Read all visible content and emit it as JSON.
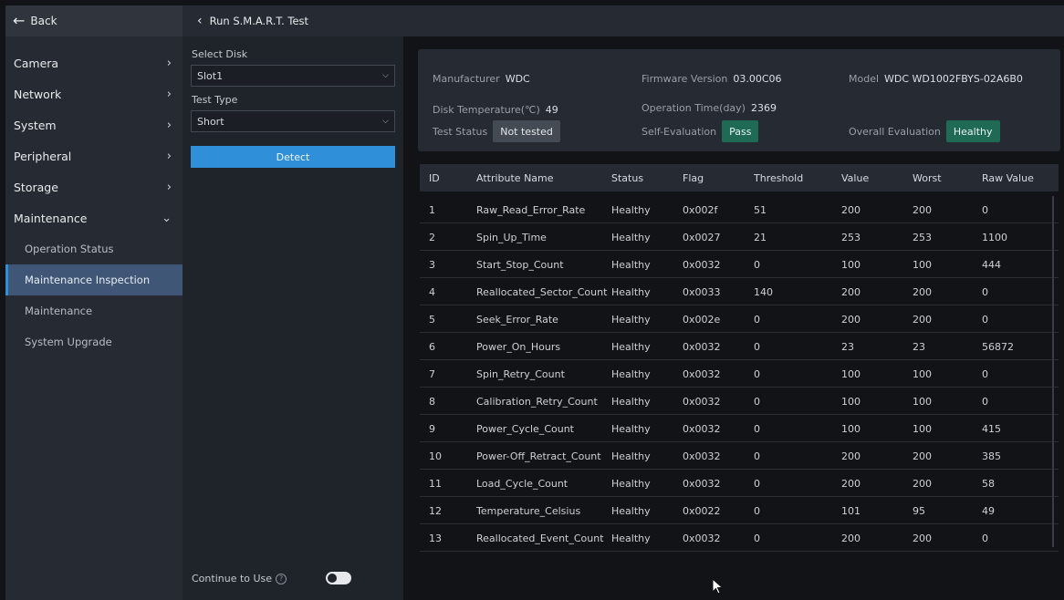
{
  "sidebar": {
    "back_label": "Back",
    "items": [
      {
        "label": "Camera"
      },
      {
        "label": "Network"
      },
      {
        "label": "System"
      },
      {
        "label": "Peripheral"
      },
      {
        "label": "Storage"
      },
      {
        "label": "Maintenance"
      }
    ],
    "sub_items": [
      {
        "label": "Operation Status"
      },
      {
        "label": "Maintenance Inspection"
      },
      {
        "label": "Maintenance"
      },
      {
        "label": "System Upgrade"
      }
    ]
  },
  "topbar": {
    "title": "Run S.M.A.R.T. Test"
  },
  "controls": {
    "select_disk_label": "Select Disk",
    "select_disk_value": "Slot1",
    "test_type_label": "Test Type",
    "test_type_value": "Short",
    "detect_label": "Detect",
    "continue_label": "Continue to Use",
    "continue_enabled": false
  },
  "info": {
    "manufacturer_key": "Manufacturer",
    "manufacturer_val": "WDC",
    "firmware_key": "Firmware Version",
    "firmware_val": "03.00C06",
    "model_key": "Model",
    "model_val": "WDC WD1002FBYS-02A6B0",
    "temp_key": "Disk Temperature(℃)",
    "temp_val": "49",
    "optime_key": "Operation Time(day)",
    "optime_val": "2369",
    "test_status_key": "Test Status",
    "test_status_val": "Not tested",
    "self_eval_key": "Self-Evaluation",
    "self_eval_val": "Pass",
    "overall_key": "Overall Evaluation",
    "overall_val": "Healthy"
  },
  "table": {
    "headers": [
      "ID",
      "Attribute Name",
      "Status",
      "Flag",
      "Threshold",
      "Value",
      "Worst",
      "Raw Value"
    ],
    "rows": [
      [
        "1",
        "Raw_Read_Error_Rate",
        "Healthy",
        "0x002f",
        "51",
        "200",
        "200",
        "0"
      ],
      [
        "2",
        "Spin_Up_Time",
        "Healthy",
        "0x0027",
        "21",
        "253",
        "253",
        "1100"
      ],
      [
        "3",
        "Start_Stop_Count",
        "Healthy",
        "0x0032",
        "0",
        "100",
        "100",
        "444"
      ],
      [
        "4",
        "Reallocated_Sector_Count",
        "Healthy",
        "0x0033",
        "140",
        "200",
        "200",
        "0"
      ],
      [
        "5",
        "Seek_Error_Rate",
        "Healthy",
        "0x002e",
        "0",
        "200",
        "200",
        "0"
      ],
      [
        "6",
        "Power_On_Hours",
        "Healthy",
        "0x0032",
        "0",
        "23",
        "23",
        "56872"
      ],
      [
        "7",
        "Spin_Retry_Count",
        "Healthy",
        "0x0032",
        "0",
        "100",
        "100",
        "0"
      ],
      [
        "8",
        "Calibration_Retry_Count",
        "Healthy",
        "0x0032",
        "0",
        "100",
        "100",
        "0"
      ],
      [
        "9",
        "Power_Cycle_Count",
        "Healthy",
        "0x0032",
        "0",
        "100",
        "100",
        "415"
      ],
      [
        "10",
        "Power-Off_Retract_Count",
        "Healthy",
        "0x0032",
        "0",
        "200",
        "200",
        "385"
      ],
      [
        "11",
        "Load_Cycle_Count",
        "Healthy",
        "0x0032",
        "0",
        "200",
        "200",
        "58"
      ],
      [
        "12",
        "Temperature_Celsius",
        "Healthy",
        "0x0022",
        "0",
        "101",
        "95",
        "49"
      ],
      [
        "13",
        "Reallocated_Event_Count",
        "Healthy",
        "0x0032",
        "0",
        "200",
        "200",
        "0"
      ]
    ]
  }
}
